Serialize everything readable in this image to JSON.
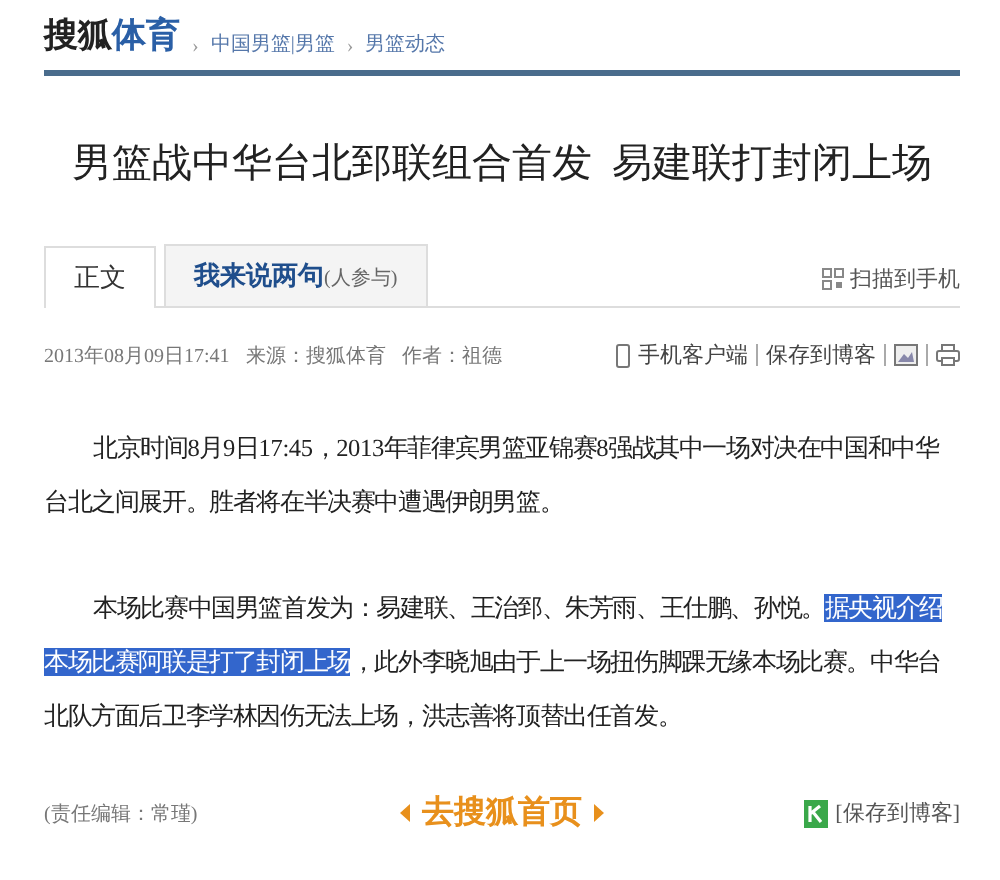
{
  "header": {
    "logo_main": "搜狐",
    "logo_accent": "体育",
    "breadcrumb": [
      "中国男篮|男篮",
      "男篮动态"
    ],
    "separator": "›"
  },
  "title": "男篮战中华台北郅联组合首发  易建联打封闭上场",
  "tabs": [
    {
      "label": "正文",
      "selected": true
    },
    {
      "label": "我来说两句",
      "note": "(人参与)",
      "selected": false
    }
  ],
  "scan_link": "扫描到手机",
  "meta": {
    "time": "2013年08月09日17:41",
    "source": "来源：搜狐体育",
    "author": "作者：祖德",
    "actions": [
      "手机客户端",
      "保存到博客"
    ]
  },
  "paragraphs": [
    [
      {
        "text": "北京时间8月9日17:45，2013年菲律宾男篮亚锦赛8强战其中一场对决在中国和中华台北之间展开。胜者将在半决赛中遭遇伊朗男篮。",
        "highlighted": false
      }
    ],
    [
      {
        "text": "本场比赛中国男篮首发为：易建联、王治郅、朱芳雨、王仕鹏、孙悦。",
        "highlighted": false
      },
      {
        "text": "据央视介绍本场比赛阿联是打了封闭上场",
        "highlighted": true
      },
      {
        "text": "，此外李晓旭由于上一场扭伤脚踝无缘本场比赛。中华台北队方面后卫李学林因伤无法上场，洪志善将顶替出任首发。",
        "highlighted": false
      }
    ]
  ],
  "footer": {
    "editor": "(责任编辑：常瑾)",
    "home_link": "去搜狐首页",
    "save": "[保存到博客]"
  }
}
